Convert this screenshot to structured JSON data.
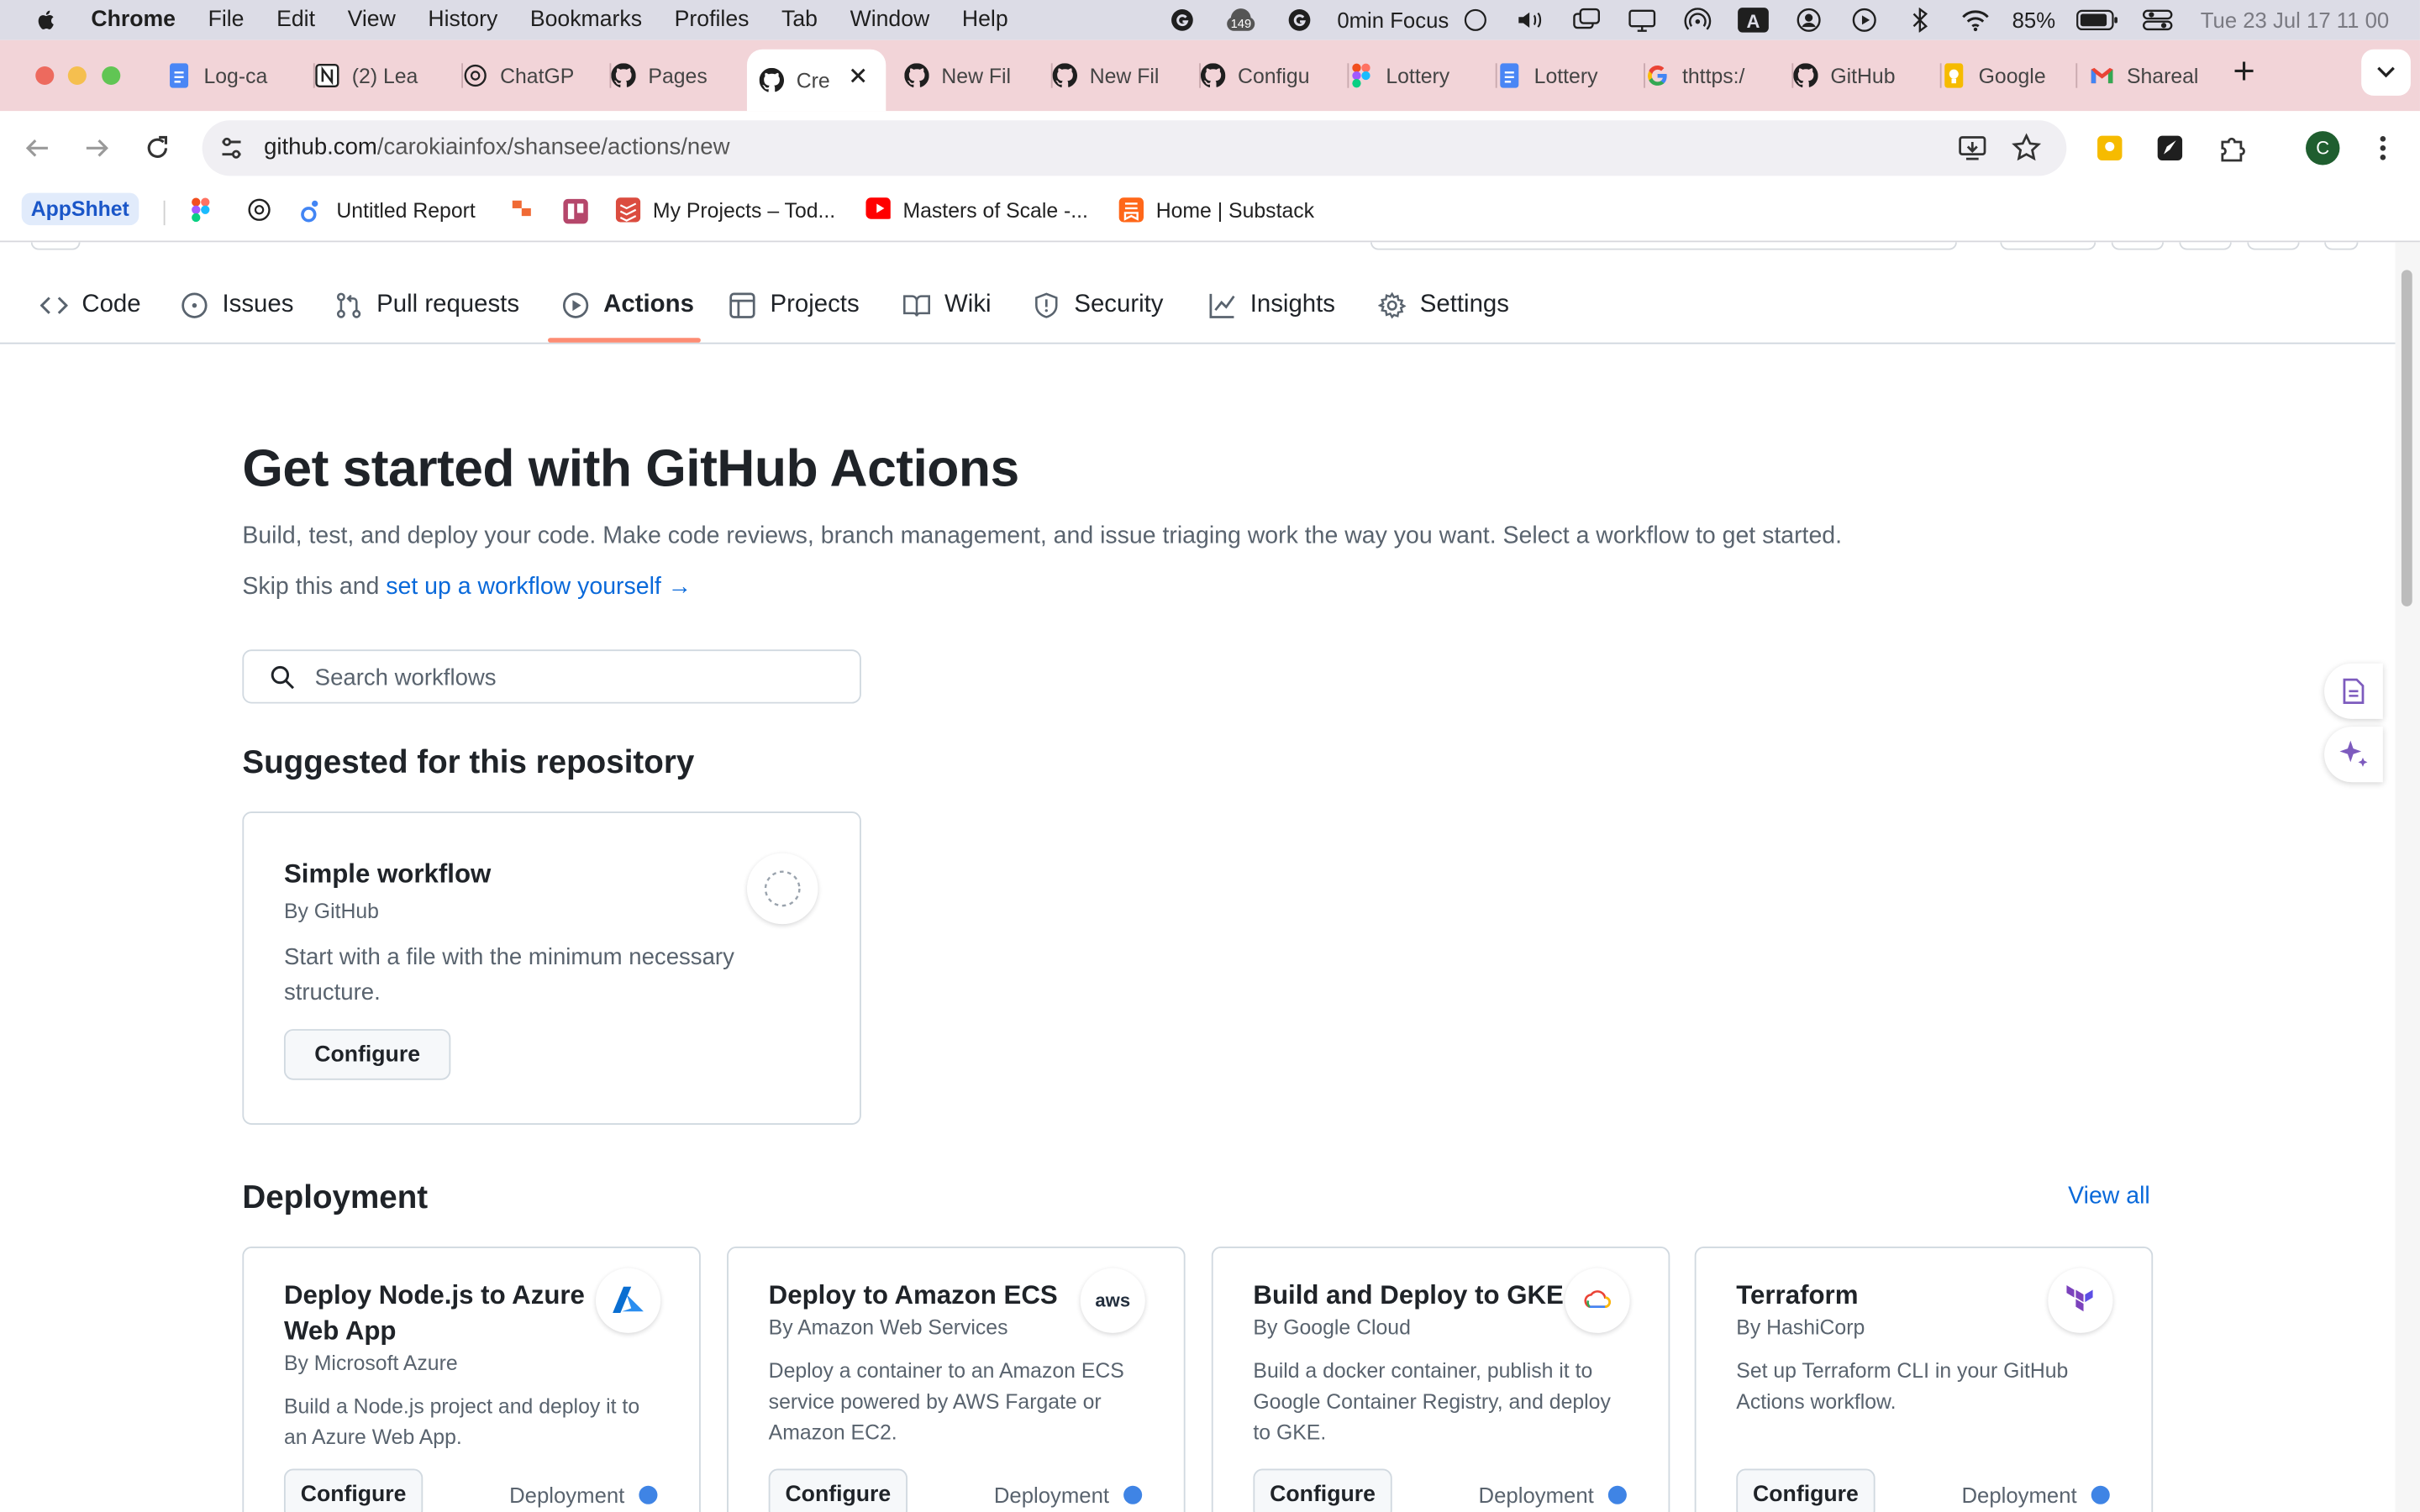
{
  "menubar": {
    "app": "Chrome",
    "items": [
      "File",
      "Edit",
      "View",
      "History",
      "Bookmarks",
      "Profiles",
      "Tab",
      "Window",
      "Help"
    ],
    "notification_count": "149",
    "focus": "0min Focus",
    "battery": "85%",
    "datetime": "Tue 23 Jul  17 11 00"
  },
  "tabs": [
    {
      "label": "Log-ca",
      "icon": "google-docs-icon"
    },
    {
      "label": "(2) Lea",
      "icon": "notion-icon"
    },
    {
      "label": "ChatGP",
      "icon": "chatgpt-icon"
    },
    {
      "label": "Pages",
      "icon": "github-icon"
    },
    {
      "label": "Cre",
      "icon": "github-icon",
      "active": true
    },
    {
      "label": "New Fil",
      "icon": "github-icon"
    },
    {
      "label": "New Fil",
      "icon": "github-icon"
    },
    {
      "label": "Configu",
      "icon": "github-icon"
    },
    {
      "label": "Lottery",
      "icon": "figma-icon"
    },
    {
      "label": "Lottery",
      "icon": "google-docs-icon"
    },
    {
      "label": "thttps:/",
      "icon": "google-icon"
    },
    {
      "label": "GitHub",
      "icon": "github-icon"
    },
    {
      "label": "Google",
      "icon": "google-keep-icon"
    },
    {
      "label": "Shareal",
      "icon": "gmail-icon"
    }
  ],
  "omnibox": {
    "host": "github.com",
    "path": "/carokiainfox/shansee/actions/new"
  },
  "avatar_initial": "C",
  "bookmarks": {
    "appsheet": "AppShhet",
    "untitled_report": "Untitled Report",
    "my_projects": "My Projects – Tod...",
    "masters_of_scale": "Masters of Scale -...",
    "substack": "Home | Substack"
  },
  "repo_nav": {
    "code": "Code",
    "issues": "Issues",
    "pull_requests": "Pull requests",
    "actions": "Actions",
    "projects": "Projects",
    "wiki": "Wiki",
    "security": "Security",
    "insights": "Insights",
    "settings": "Settings"
  },
  "main": {
    "title": "Get started with GitHub Actions",
    "lead": "Build, test, and deploy your code. Make code reviews, branch management, and issue triaging work the way you want. Select a workflow to get started.",
    "skip_prefix": "Skip this and ",
    "skip_link": "set up a workflow yourself",
    "skip_arrow": "→",
    "search_placeholder": "Search workflows",
    "suggested_heading": "Suggested for this repository",
    "deployment_heading": "Deployment",
    "view_all": "View all"
  },
  "suggested_card": {
    "title": "Simple workflow",
    "by": "By GitHub",
    "desc_line1": "Start with a file with the minimum necessary",
    "desc_line2": "structure.",
    "button": "Configure"
  },
  "deployment_cards": [
    {
      "title_line1": "Deploy Node.js to Azure",
      "title_line2": "Web App",
      "by": "By Microsoft Azure",
      "desc_line1": "Build a Node.js project and deploy it to",
      "desc_line2": "an Azure Web App.",
      "desc_line3": "",
      "button": "Configure",
      "category": "Deployment",
      "logo": "azure-logo-icon"
    },
    {
      "title_line1": "Deploy to Amazon ECS",
      "title_line2": "",
      "by": "By Amazon Web Services",
      "desc_line1": "Deploy a container to an Amazon ECS",
      "desc_line2": "service powered by AWS Fargate or",
      "desc_line3": "Amazon EC2.",
      "button": "Configure",
      "category": "Deployment",
      "logo": "aws-logo-icon",
      "logo_text": "aws"
    },
    {
      "title_line1": "Build and Deploy to GKE",
      "title_line2": "",
      "by": "By Google Cloud",
      "desc_line1": "Build a docker container, publish it to",
      "desc_line2": "Google Container Registry, and deploy",
      "desc_line3": "to GKE.",
      "button": "Configure",
      "category": "Deployment",
      "logo": "google-cloud-logo-icon"
    },
    {
      "title_line1": "Terraform",
      "title_line2": "",
      "by": "By HashiCorp",
      "desc_line1": "Set up Terraform CLI in your GitHub",
      "desc_line2": "Actions workflow.",
      "desc_line3": "",
      "button": "Configure",
      "category": "Deployment",
      "logo": "terraform-logo-icon"
    }
  ],
  "colors": {
    "tabstrip": "#f2d4d8",
    "link": "#0969da",
    "nav_underline": "#fd8c73",
    "category_dot": "#3f84e5",
    "button_bg": "#f6f8fa"
  }
}
